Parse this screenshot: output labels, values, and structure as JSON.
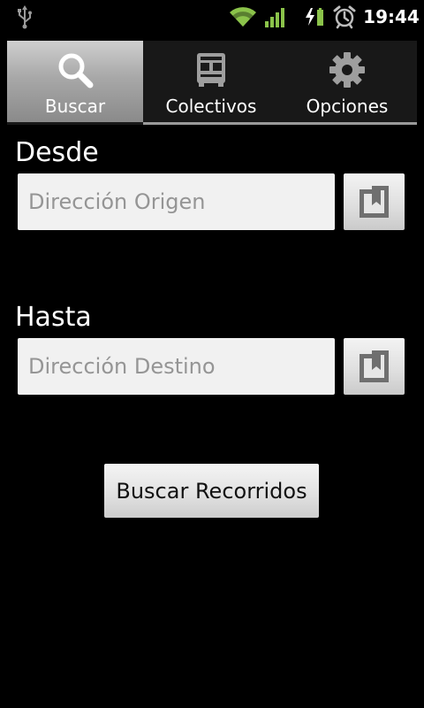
{
  "status_bar": {
    "time": "19:44",
    "icons": [
      "usb-icon",
      "wifi-icon",
      "signal-icon",
      "battery-charging-icon",
      "alarm-icon"
    ],
    "accent_color": "#8bc34a"
  },
  "tabs": [
    {
      "label": "Buscar",
      "icon": "search-icon",
      "selected": true
    },
    {
      "label": "Colectivos",
      "icon": "bus-icon",
      "selected": false
    },
    {
      "label": "Opciones",
      "icon": "gear-icon",
      "selected": false
    }
  ],
  "form": {
    "origin": {
      "label": "Desde",
      "value": "",
      "placeholder": "Dirección Origen",
      "bookmark_icon": "bookmark-icon"
    },
    "destination": {
      "label": "Hasta",
      "value": "",
      "placeholder": "Dirección Destino",
      "bookmark_icon": "bookmark-icon"
    },
    "search_button_label": "Buscar Recorridos"
  }
}
